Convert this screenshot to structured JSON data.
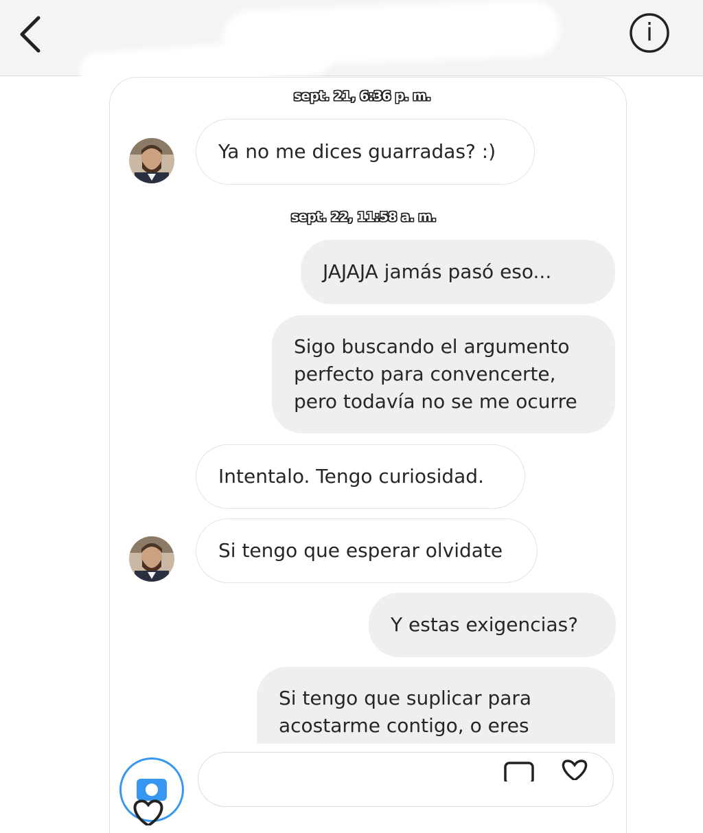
{
  "header": {
    "back_icon": "chevron-left-icon",
    "info_icon": "info-circle-icon",
    "info_glyph": "i"
  },
  "conversation": {
    "messages": [
      {
        "kind": "timestamp",
        "text": "sept. 21, 6:36 p. m."
      },
      {
        "kind": "incoming",
        "text": "Ya no me dices guarradas? :)",
        "avatar": true
      },
      {
        "kind": "timestamp",
        "text": "sept. 22, 11:58 a. m."
      },
      {
        "kind": "outgoing",
        "text": "JAJAJA jamás pasó eso..."
      },
      {
        "kind": "outgoing",
        "lines": [
          "Sigo buscando el argumento",
          "perfecto para convencerte,",
          "pero todavía no se me ocurre"
        ]
      },
      {
        "kind": "incoming",
        "text": "Intentalo. Tengo curiosidad.",
        "avatar": false
      },
      {
        "kind": "incoming",
        "text": "Si tengo que esperar olvidate",
        "avatar": true
      },
      {
        "kind": "outgoing",
        "text": "Y estas exigencias?"
      },
      {
        "kind": "outgoing",
        "lines": [
          "Si tengo que suplicar para",
          "acostarme contigo, o eres"
        ]
      }
    ]
  },
  "composer": {
    "camera_icon": "camera-icon",
    "gallery_icon": "gallery-icon",
    "heart_icon": "heart-icon"
  },
  "colors": {
    "outgoing_bubble": "#efefef",
    "incoming_border": "#e2e2e2",
    "accent": "#3797f0",
    "text": "#262626"
  }
}
